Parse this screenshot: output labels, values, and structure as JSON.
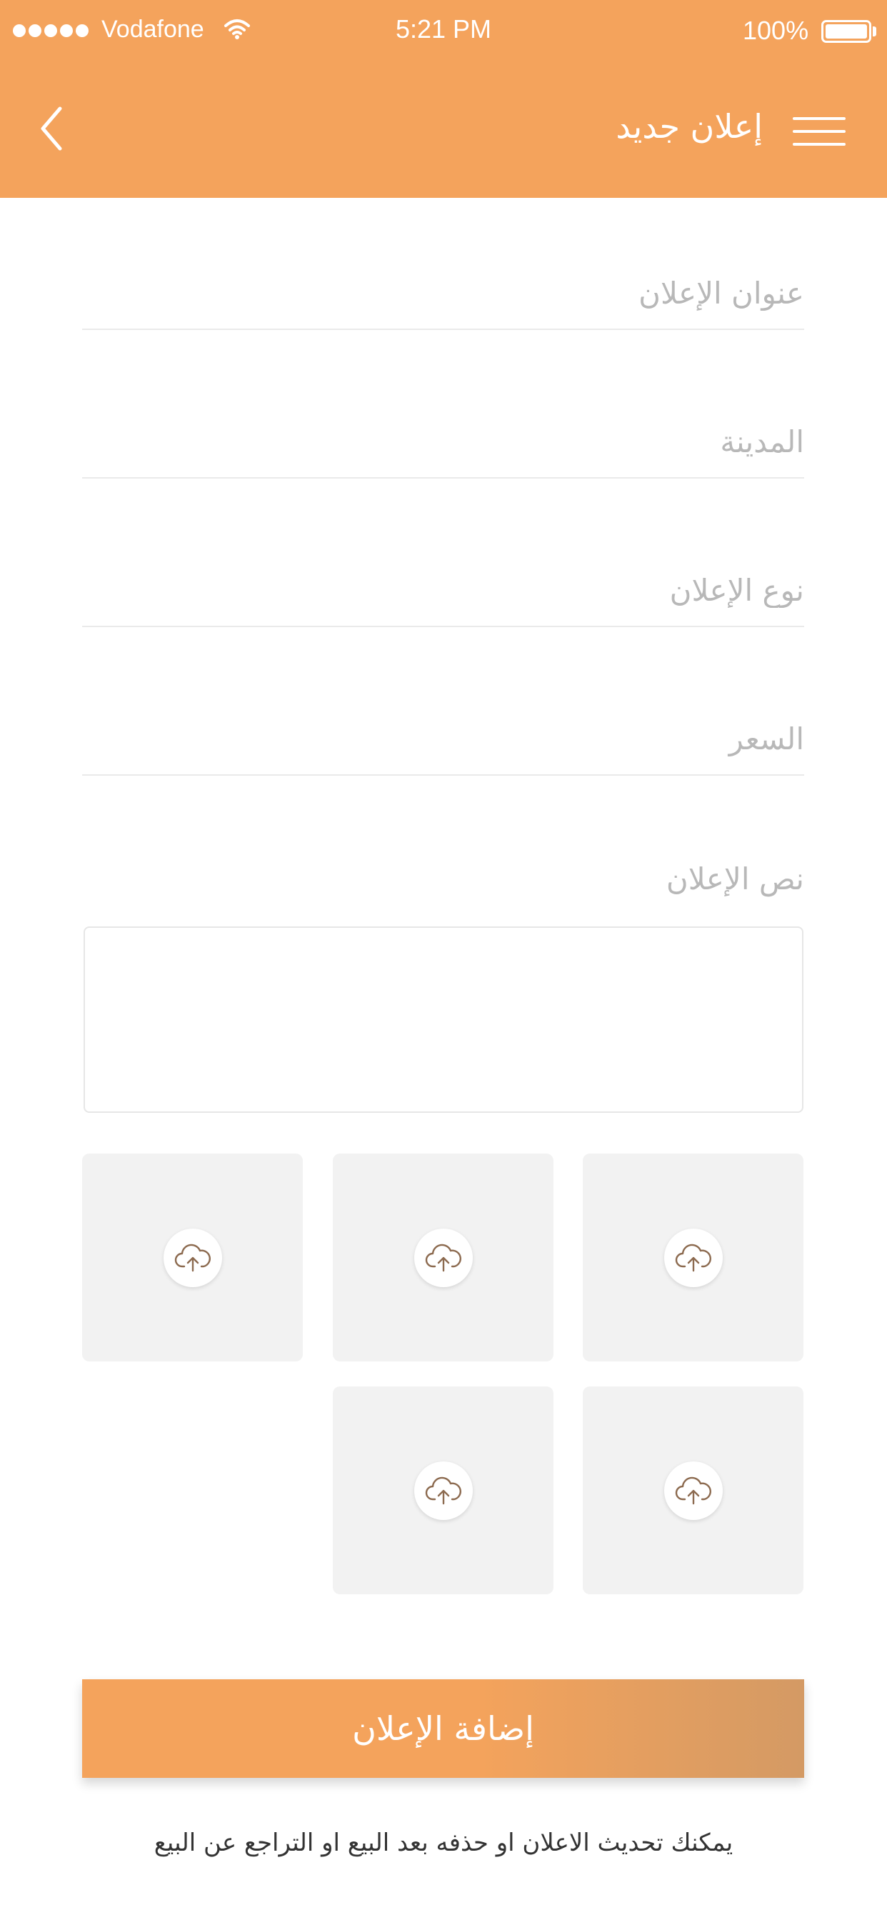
{
  "status_bar": {
    "carrier": "Vodafone",
    "time": "5:21 PM",
    "battery": "100%",
    "icons": [
      "signal-dots-icon",
      "wifi-icon",
      "battery-icon"
    ]
  },
  "header": {
    "title": "إعلان جديد",
    "back_icon": "chevron-left-icon",
    "menu_icon": "hamburger-menu-icon",
    "background_color": "#F4A35C"
  },
  "form": {
    "fields": [
      {
        "placeholder": "عنوان الإعلان",
        "value": ""
      },
      {
        "placeholder": "المدينة",
        "value": ""
      },
      {
        "placeholder": "نوع الإعلان",
        "value": ""
      },
      {
        "placeholder": "السعر",
        "value": ""
      }
    ],
    "text_label": "نص الإعلان",
    "text_value": ""
  },
  "uploads": {
    "count": 5,
    "icon": "cloud-upload-icon",
    "icon_color": "#8C6A4F"
  },
  "submit": {
    "label": "إضافة الإعلان",
    "color": "#F4A35C"
  },
  "note": "يمكنك تحديث الاعلان او حذفه بعد البيع او التراجع عن البيع"
}
